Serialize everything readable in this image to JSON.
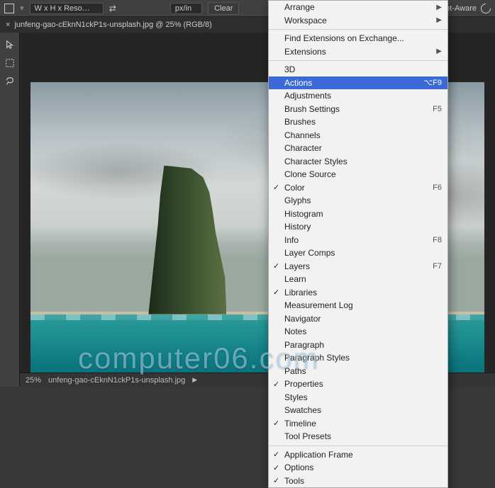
{
  "topbar": {
    "preset_label": "W x H x Reso…",
    "unit_label": "px/in",
    "clear_label": "Clear",
    "content_aware_label": "ntent-Aware"
  },
  "tab": {
    "title": "junfeng-gao-cEknN1ckP1s-unsplash.jpg @ 25% (RGB/8)"
  },
  "statusbar": {
    "zoom": "25%",
    "filepath": "unfeng-gao-cEknN1ckP1s-unsplash.jpg"
  },
  "watermark": "computer06.com",
  "menu": {
    "groups": [
      [
        {
          "label": "Arrange",
          "submenu": true
        },
        {
          "label": "Workspace",
          "submenu": true
        }
      ],
      [
        {
          "label": "Find Extensions on Exchange..."
        },
        {
          "label": "Extensions",
          "submenu": true
        }
      ],
      [
        {
          "label": "3D"
        },
        {
          "label": "Actions",
          "shortcut": "⌥F9",
          "highlighted": true
        },
        {
          "label": "Adjustments"
        },
        {
          "label": "Brush Settings",
          "shortcut": "F5"
        },
        {
          "label": "Brushes"
        },
        {
          "label": "Channels"
        },
        {
          "label": "Character"
        },
        {
          "label": "Character Styles"
        },
        {
          "label": "Clone Source"
        },
        {
          "label": "Color",
          "checked": true,
          "shortcut": "F6"
        },
        {
          "label": "Glyphs"
        },
        {
          "label": "Histogram"
        },
        {
          "label": "History"
        },
        {
          "label": "Info",
          "shortcut": "F8"
        },
        {
          "label": "Layer Comps"
        },
        {
          "label": "Layers",
          "checked": true,
          "shortcut": "F7"
        },
        {
          "label": "Learn"
        },
        {
          "label": "Libraries",
          "checked": true
        },
        {
          "label": "Measurement Log"
        },
        {
          "label": "Navigator"
        },
        {
          "label": "Notes"
        },
        {
          "label": "Paragraph"
        },
        {
          "label": "Paragraph Styles"
        },
        {
          "label": "Paths"
        },
        {
          "label": "Properties",
          "checked": true
        },
        {
          "label": "Styles"
        },
        {
          "label": "Swatches"
        },
        {
          "label": "Timeline",
          "checked": true
        },
        {
          "label": "Tool Presets"
        }
      ],
      [
        {
          "label": "Application Frame",
          "checked": true
        },
        {
          "label": "Options",
          "checked": true
        },
        {
          "label": "Tools",
          "checked": true
        }
      ]
    ]
  }
}
